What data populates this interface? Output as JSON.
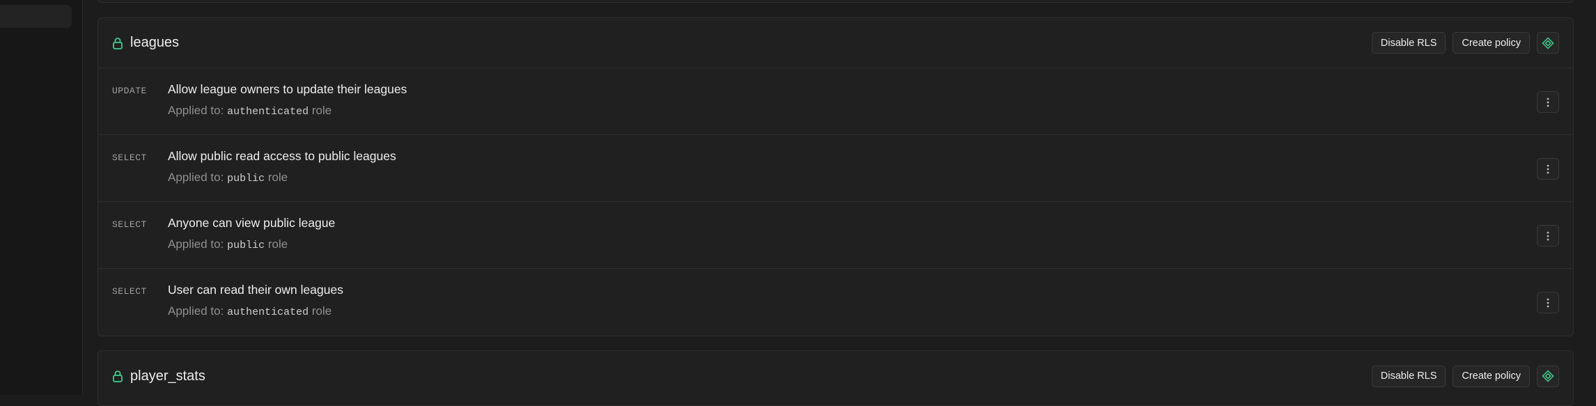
{
  "colors": {
    "accent": "#3ecf8e",
    "background": "#1c1c1c",
    "card": "#202020",
    "border": "#2e2e2e"
  },
  "tables": [
    {
      "name": "leagues",
      "disable_rls_label": "Disable RLS",
      "create_policy_label": "Create policy",
      "policies": [
        {
          "command": "UPDATE",
          "name": "Allow league owners to update their leagues",
          "applied_prefix": "Applied to:",
          "role": "authenticated",
          "role_suffix": "role"
        },
        {
          "command": "SELECT",
          "name": "Allow public read access to public leagues",
          "applied_prefix": "Applied to:",
          "role": "public",
          "role_suffix": "role"
        },
        {
          "command": "SELECT",
          "name": "Anyone can view public league",
          "applied_prefix": "Applied to:",
          "role": "public",
          "role_suffix": "role"
        },
        {
          "command": "SELECT",
          "name": "User can read their own leagues",
          "applied_prefix": "Applied to:",
          "role": "authenticated",
          "role_suffix": "role"
        }
      ]
    },
    {
      "name": "player_stats",
      "disable_rls_label": "Disable RLS",
      "create_policy_label": "Create policy",
      "policies": []
    }
  ],
  "icons": {
    "lock": "lock-icon",
    "assistant": "diamond-icon",
    "more": "more-vertical-icon"
  }
}
